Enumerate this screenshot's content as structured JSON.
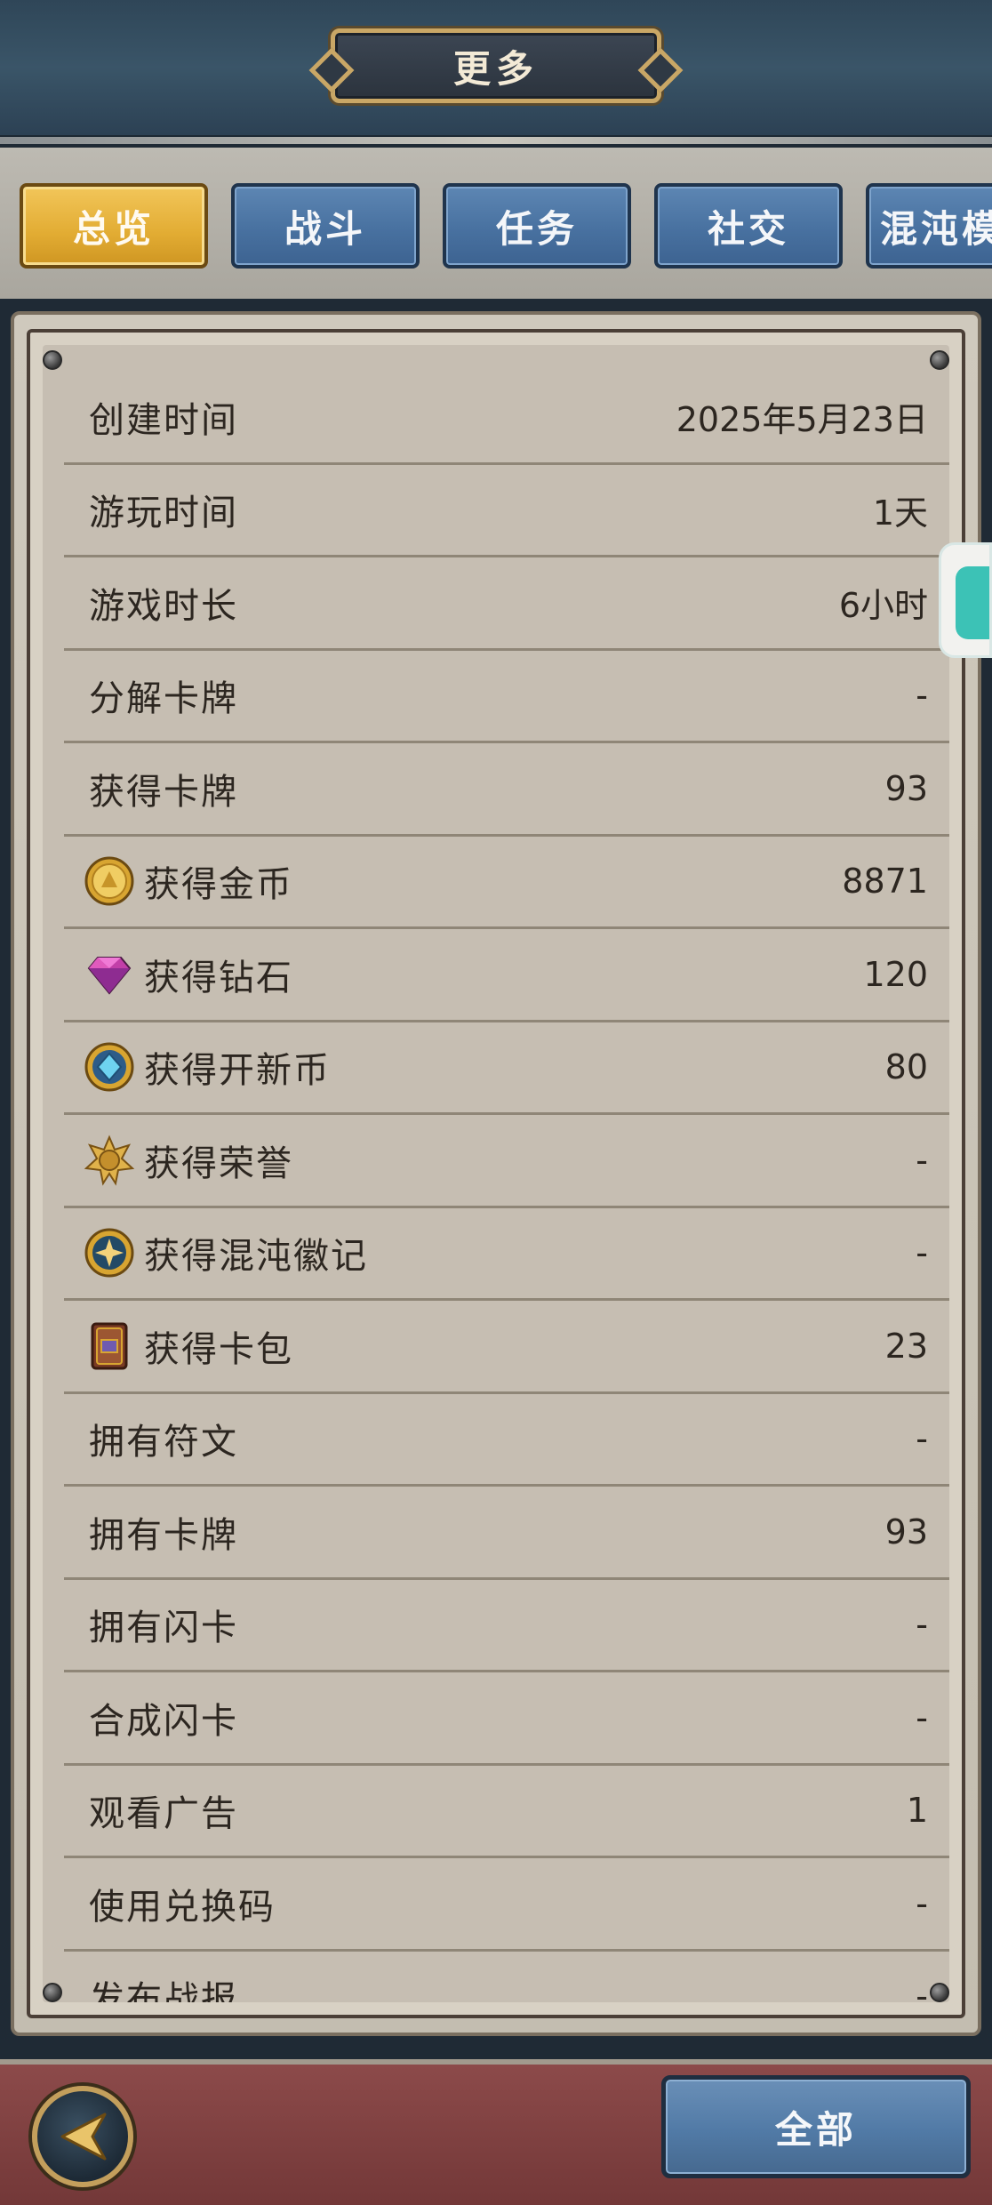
{
  "header": {
    "title": "更多"
  },
  "tabs": [
    {
      "label": "总览",
      "active": true
    },
    {
      "label": "战斗",
      "active": false
    },
    {
      "label": "任务",
      "active": false
    },
    {
      "label": "社交",
      "active": false
    },
    {
      "label": "混沌模",
      "active": false
    }
  ],
  "stats": [
    {
      "label": "创建时间",
      "value": "2025年5月23日",
      "icon": ""
    },
    {
      "label": "游玩时间",
      "value": "1天",
      "icon": ""
    },
    {
      "label": "游戏时长",
      "value": "6小时",
      "icon": ""
    },
    {
      "label": "分解卡牌",
      "value": "-",
      "icon": ""
    },
    {
      "label": "获得卡牌",
      "value": "93",
      "icon": ""
    },
    {
      "label": "获得金币",
      "value": "8871",
      "icon": "gold-coin-icon"
    },
    {
      "label": "获得钻石",
      "value": "120",
      "icon": "diamond-icon"
    },
    {
      "label": "获得开新币",
      "value": "80",
      "icon": "blue-gem-coin-icon"
    },
    {
      "label": "获得荣誉",
      "value": "-",
      "icon": "honor-medal-icon"
    },
    {
      "label": "获得混沌徽记",
      "value": "-",
      "icon": "chaos-emblem-icon"
    },
    {
      "label": "获得卡包",
      "value": "23",
      "icon": "card-pack-icon"
    },
    {
      "label": "拥有符文",
      "value": "-",
      "icon": ""
    },
    {
      "label": "拥有卡牌",
      "value": "93",
      "icon": ""
    },
    {
      "label": "拥有闪卡",
      "value": "-",
      "icon": ""
    },
    {
      "label": "合成闪卡",
      "value": "-",
      "icon": ""
    },
    {
      "label": "观看广告",
      "value": "1",
      "icon": ""
    },
    {
      "label": "使用兑换码",
      "value": "-",
      "icon": ""
    },
    {
      "label": "发布战报",
      "value": "-",
      "icon": ""
    }
  ],
  "footer": {
    "all_label": "全部"
  },
  "colors": {
    "tab_active": "#e2ac33",
    "tab_inactive": "#4871a0",
    "bottom_bar": "#7d4040"
  }
}
